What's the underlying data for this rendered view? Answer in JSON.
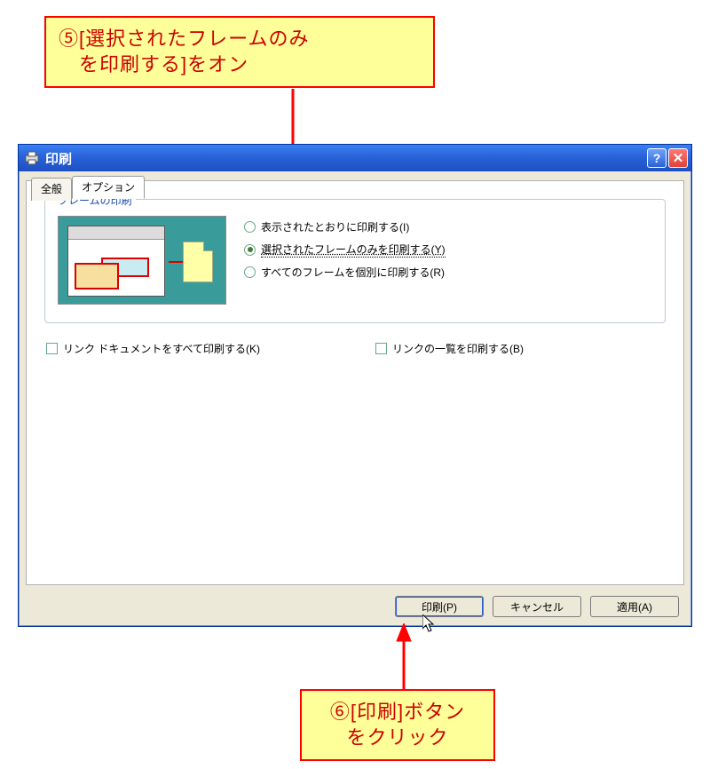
{
  "callout5": "⑤[選択されたフレームのみ\n　を印刷する]をオン",
  "callout6": "⑥[印刷]ボタン\nをクリック",
  "dialog": {
    "title": "印刷",
    "tabs": {
      "general": "全般",
      "options": "オプション"
    },
    "group": {
      "legend": "フレームの印刷",
      "radios": {
        "asis": "表示されたとおりに印刷する(I)",
        "selected": "選択されたフレームのみを印刷する(Y)",
        "each": "すべてのフレームを個別に印刷する(R)"
      }
    },
    "checks": {
      "linkdocs": "リンク ドキュメントをすべて印刷する(K)",
      "linktable": "リンクの一覧を印刷する(B)"
    },
    "buttons": {
      "print": "印刷(P)",
      "cancel": "キャンセル",
      "apply": "適用(A)"
    }
  }
}
